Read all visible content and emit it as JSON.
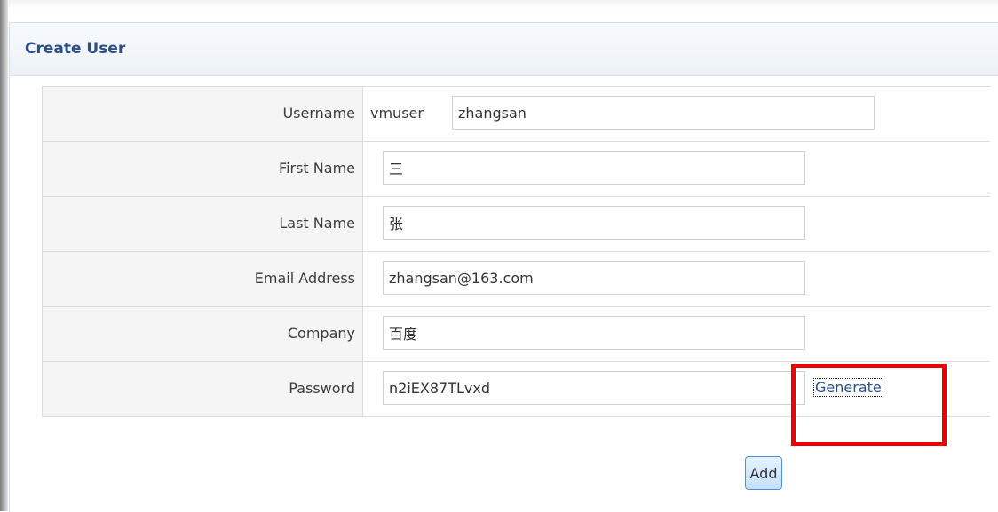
{
  "panel": {
    "title": "Create User"
  },
  "form": {
    "username": {
      "label": "Username",
      "prefix": "vmuser",
      "value": "zhangsan"
    },
    "first_name": {
      "label": "First Name",
      "value": "三"
    },
    "last_name": {
      "label": "Last Name",
      "value": "张"
    },
    "email": {
      "label": "Email Address",
      "value": "zhangsan@163.com"
    },
    "company": {
      "label": "Company",
      "value": "百度"
    },
    "password": {
      "label": "Password",
      "value": "n2iEX87TLvxd",
      "generate_label": "Generate"
    }
  },
  "actions": {
    "add_label": "Add"
  },
  "colors": {
    "title": "#2b4f86",
    "highlight": "#ee0000",
    "link": "#2b4f86"
  }
}
